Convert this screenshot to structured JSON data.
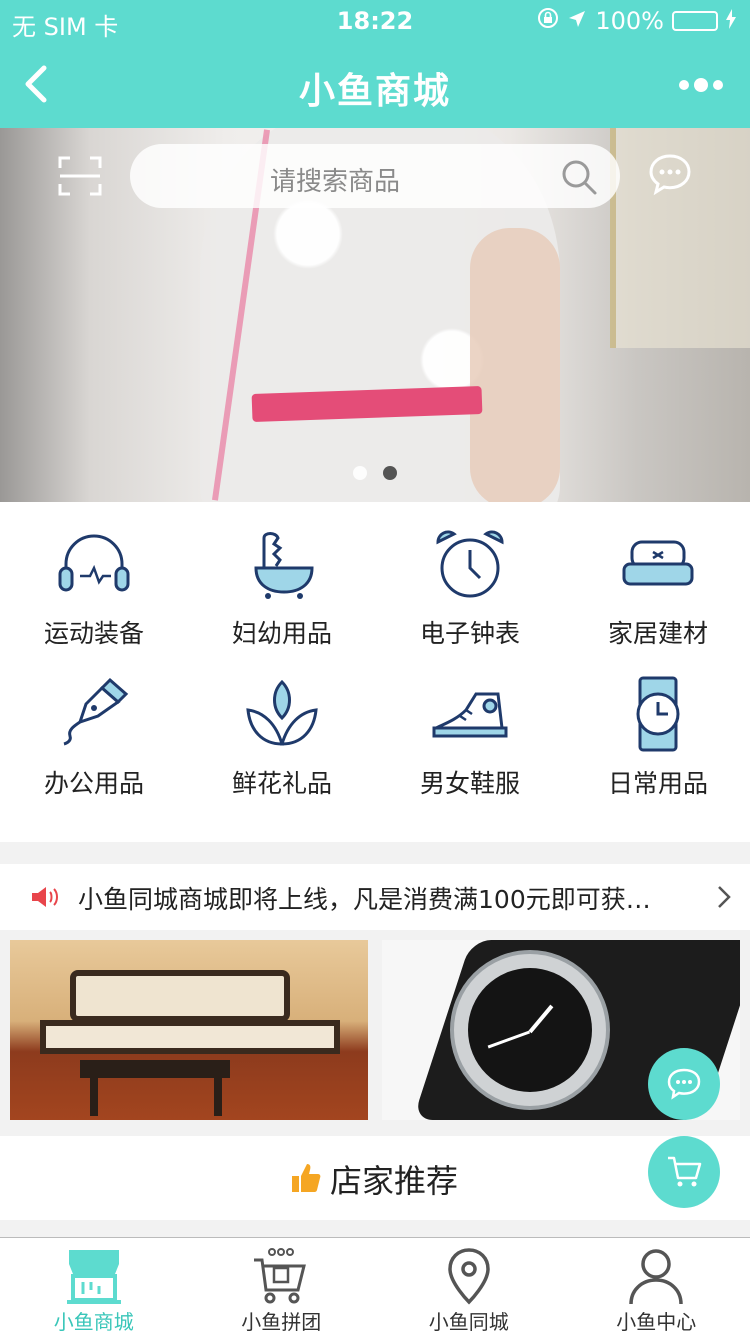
{
  "status_bar": {
    "carrier": "无 SIM 卡",
    "time": "18:22",
    "battery": "100%"
  },
  "header": {
    "title": "小鱼商城"
  },
  "search": {
    "placeholder": "请搜索商品"
  },
  "banner": {
    "page_count": 2,
    "active_index": 1
  },
  "categories": [
    {
      "label": "运动装备",
      "icon": "headphones-icon"
    },
    {
      "label": "妇幼用品",
      "icon": "baby-bath-icon"
    },
    {
      "label": "电子钟表",
      "icon": "alarm-clock-icon"
    },
    {
      "label": "家居建材",
      "icon": "sofa-icon"
    },
    {
      "label": "办公用品",
      "icon": "pen-icon"
    },
    {
      "label": "鲜花礼品",
      "icon": "lotus-icon"
    },
    {
      "label": "男女鞋服",
      "icon": "sneaker-icon"
    },
    {
      "label": "日常用品",
      "icon": "watch-icon"
    }
  ],
  "notice": {
    "text": "小鱼同城商城即将上线，凡是消费满100元即可获…"
  },
  "recommend": {
    "title": "店家推荐"
  },
  "tabbar": [
    {
      "label": "小鱼商城",
      "icon": "store-icon",
      "active": true
    },
    {
      "label": "小鱼拼团",
      "icon": "group-cart-icon",
      "active": false
    },
    {
      "label": "小鱼同城",
      "icon": "location-pin-icon",
      "active": false
    },
    {
      "label": "小鱼中心",
      "icon": "user-icon",
      "active": false
    }
  ],
  "colors": {
    "brand": "#5ddbcf",
    "icon_stroke": "#1f3a6b",
    "icon_fill": "#9fd6e8",
    "tab_active": "#39c6b9",
    "notice_speaker": "#e8454b"
  }
}
